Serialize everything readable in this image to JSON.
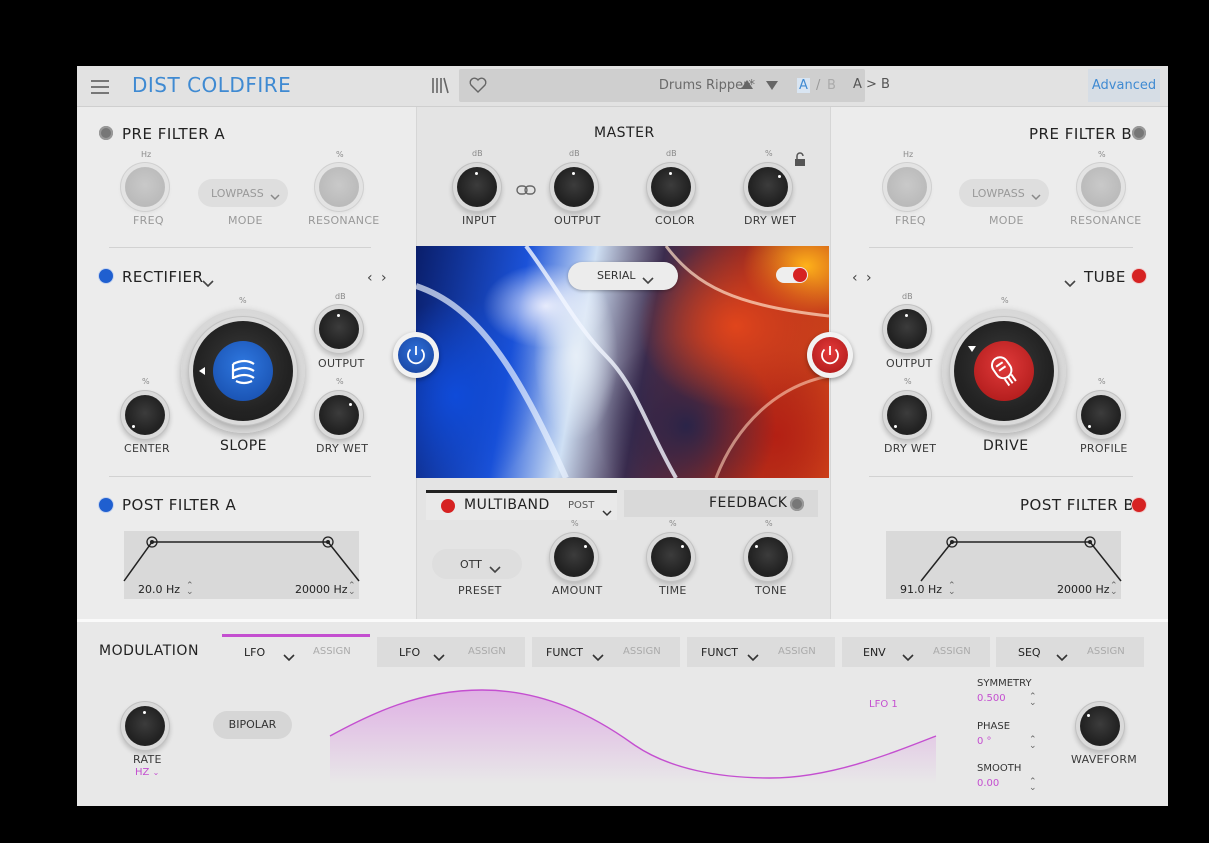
{
  "app": {
    "title": "DIST COLDFIRE"
  },
  "topbar": {
    "preset_name": "Drums Ripper*",
    "ab_a": "A",
    "ab_slash": "/",
    "ab_b": "B",
    "ab_copy": "A > B",
    "advanced": "Advanced",
    "icons": [
      "menu-icon",
      "library-icon",
      "heart-icon",
      "up-arrow-icon",
      "down-arrow-icon"
    ]
  },
  "pre_filter_a": {
    "title": "PRE FILTER A",
    "freq_unit": "Hz",
    "freq_label": "FREQ",
    "mode_value": "LOWPASS",
    "mode_label": "MODE",
    "res_unit": "%",
    "res_label": "RESONANCE"
  },
  "pre_filter_b": {
    "title": "PRE FILTER B",
    "freq_unit": "Hz",
    "freq_label": "FREQ",
    "mode_value": "LOWPASS",
    "mode_label": "MODE",
    "res_unit": "%",
    "res_label": "RESONANCE"
  },
  "master": {
    "title": "MASTER",
    "input_unit": "dB",
    "input_label": "INPUT",
    "output_unit": "dB",
    "output_label": "OUTPUT",
    "color_unit": "dB",
    "color_label": "COLOR",
    "drywet_unit": "%",
    "drywet_label": "DRY WET",
    "routing": "SERIAL"
  },
  "rectifier": {
    "title": "RECTIFIER",
    "slope_unit": "%",
    "slope_label": "SLOPE",
    "output_unit": "dB",
    "output_label": "OUTPUT",
    "center_unit": "%",
    "center_label": "CENTER",
    "drywet_unit": "%",
    "drywet_label": "DRY WET"
  },
  "tube": {
    "title": "TUBE",
    "drive_unit": "%",
    "drive_label": "DRIVE",
    "output_unit": "dB",
    "output_label": "OUTPUT",
    "drywet_unit": "%",
    "drywet_label": "DRY WET",
    "profile_unit": "%",
    "profile_label": "PROFILE"
  },
  "post_filter_a": {
    "title": "POST FILTER A",
    "low": "20.0 Hz",
    "high": "20000 Hz"
  },
  "post_filter_b": {
    "title": "POST FILTER B",
    "low": "91.0 Hz",
    "high": "20000 Hz"
  },
  "multiband": {
    "title": "MULTIBAND",
    "position": "POST",
    "feedback": "FEEDBACK",
    "preset_value": "OTT",
    "preset_label": "PRESET",
    "amount_unit": "%",
    "amount_label": "AMOUNT",
    "time_unit": "%",
    "time_label": "TIME",
    "tone_unit": "%",
    "tone_label": "TONE"
  },
  "modulation": {
    "title": "MODULATION",
    "tabs": [
      {
        "type": "LFO",
        "assign": "ASSIGN",
        "active": true
      },
      {
        "type": "LFO",
        "assign": "ASSIGN",
        "active": false
      },
      {
        "type": "FUNCT",
        "assign": "ASSIGN",
        "active": false
      },
      {
        "type": "FUNCT",
        "assign": "ASSIGN",
        "active": false
      },
      {
        "type": "ENV",
        "assign": "ASSIGN",
        "active": false
      },
      {
        "type": "SEQ",
        "assign": "ASSIGN",
        "active": false
      }
    ],
    "rate_label": "RATE",
    "rate_unit": "HZ",
    "bipolar": "BIPOLAR",
    "curve_label": "LFO 1",
    "symmetry_label": "SYMMETRY",
    "symmetry_value": "0.500",
    "phase_label": "PHASE",
    "phase_value": "0 °",
    "smooth_label": "SMOOTH",
    "smooth_value": "0.00",
    "waveform_label": "WAVEFORM"
  },
  "colors": {
    "accent_blue": "#3f8ad2",
    "brand_blue": "#1f5fd0",
    "brand_red": "#d62222",
    "mod_purple": "#c44fd0"
  }
}
